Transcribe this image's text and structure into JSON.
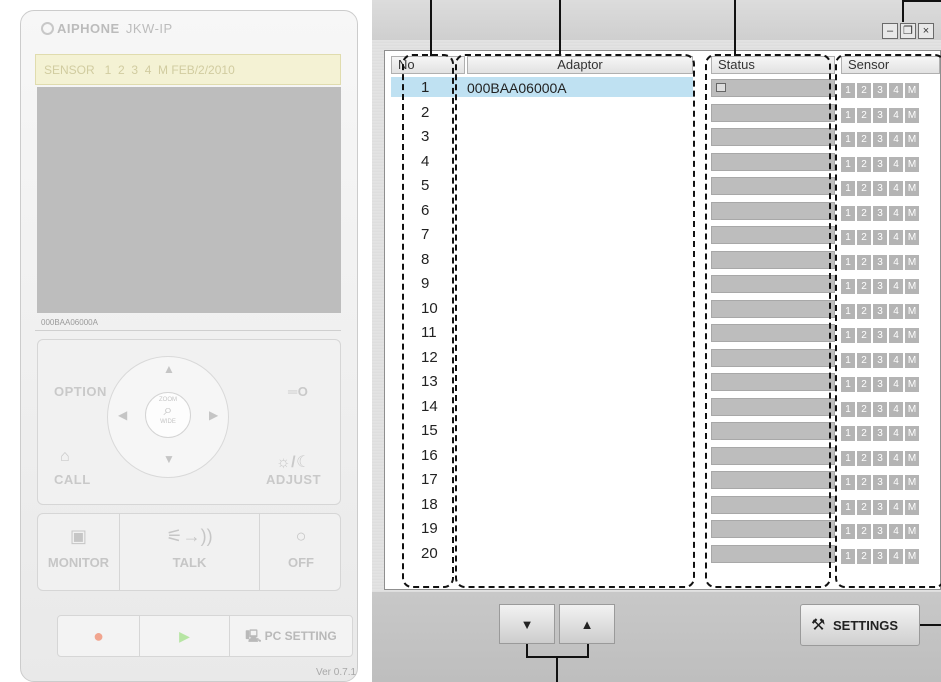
{
  "station": {
    "brand": "AIPHONE",
    "model": "JKW-IP",
    "info_bar": "SENSOR   1  2  3  4  M FEB/2/2010",
    "screen_id": "000BAA06000A",
    "option_label": "OPTION",
    "key_label": "═O",
    "zoom_top": "ZOOM",
    "zoom_bottom": "WIDE",
    "call_label": "CALL",
    "adjust_label": "ADJUST",
    "monitor_label": "MONITOR",
    "talk_label": "TALK",
    "off_label": "OFF",
    "pc_setting_label": "PC SETTING",
    "version": "Ver 0.7.1"
  },
  "table": {
    "headers": {
      "no": "No",
      "adaptor": "Adaptor",
      "status": "Status",
      "sensor": "Sensor"
    },
    "rows": [
      {
        "no": "1",
        "adaptor": "000BAA06000A"
      },
      {
        "no": "2",
        "adaptor": ""
      },
      {
        "no": "3",
        "adaptor": ""
      },
      {
        "no": "4",
        "adaptor": ""
      },
      {
        "no": "5",
        "adaptor": ""
      },
      {
        "no": "6",
        "adaptor": ""
      },
      {
        "no": "7",
        "adaptor": ""
      },
      {
        "no": "8",
        "adaptor": ""
      },
      {
        "no": "9",
        "adaptor": ""
      },
      {
        "no": "10",
        "adaptor": ""
      },
      {
        "no": "11",
        "adaptor": ""
      },
      {
        "no": "12",
        "adaptor": ""
      },
      {
        "no": "13",
        "adaptor": ""
      },
      {
        "no": "14",
        "adaptor": ""
      },
      {
        "no": "15",
        "adaptor": ""
      },
      {
        "no": "16",
        "adaptor": ""
      },
      {
        "no": "17",
        "adaptor": ""
      },
      {
        "no": "18",
        "adaptor": ""
      },
      {
        "no": "19",
        "adaptor": ""
      },
      {
        "no": "20",
        "adaptor": ""
      }
    ],
    "sensor_labels": [
      "1",
      "2",
      "3",
      "4",
      "M"
    ],
    "selected_row": 1
  },
  "controls": {
    "down_label": "▼",
    "up_label": "▲",
    "settings_label": "SETTINGS"
  },
  "window_buttons": {
    "minimize": "–",
    "restore": "❐",
    "close": "×"
  },
  "colors": {
    "selection": "#bfe1f2",
    "sensor_box": "#b4b4b4",
    "status_bar": "#bdbdbd"
  }
}
